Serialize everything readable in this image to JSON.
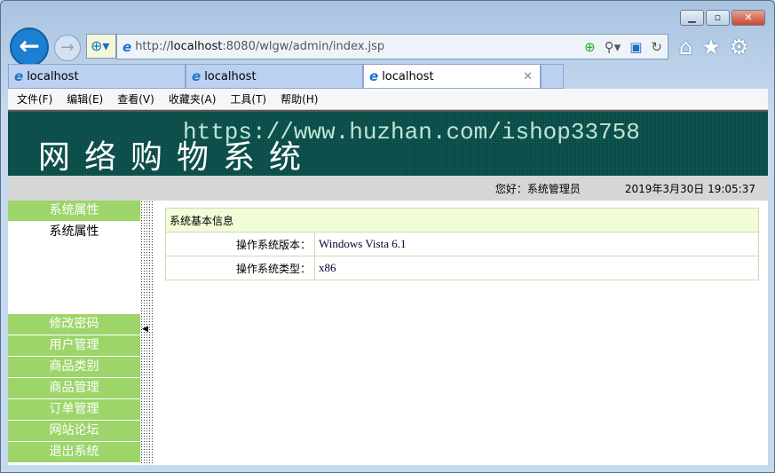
{
  "browser": {
    "url_prefix": "http://",
    "url_host": "localhost",
    "url_rest": ":8080/wlgw/admin/index.jsp",
    "tabs": [
      {
        "label": "localhost"
      },
      {
        "label": "localhost"
      },
      {
        "label": "localhost"
      }
    ],
    "menu": [
      "文件(F)",
      "编辑(E)",
      "查看(V)",
      "收藏夹(A)",
      "工具(T)",
      "帮助(H)"
    ]
  },
  "banner": {
    "title": "网络购物系统",
    "watermark": "https://www.huzhan.com/ishop33758"
  },
  "userbar": {
    "greeting": "您好：系统管理员",
    "datetime": "2019年3月30日  19:05:37"
  },
  "sidebar": {
    "section": "系统属性",
    "sub_item": "系统属性",
    "items": [
      "修改密码",
      "用户管理",
      "商品类别",
      "商品管理",
      "订单管理",
      "网站论坛",
      "退出系统"
    ]
  },
  "info": {
    "header": "系统基本信息",
    "rows": [
      {
        "label": "操作系统版本：",
        "value": "Windows Vista  6.1"
      },
      {
        "label": "操作系统类型：",
        "value": "x86"
      }
    ]
  }
}
